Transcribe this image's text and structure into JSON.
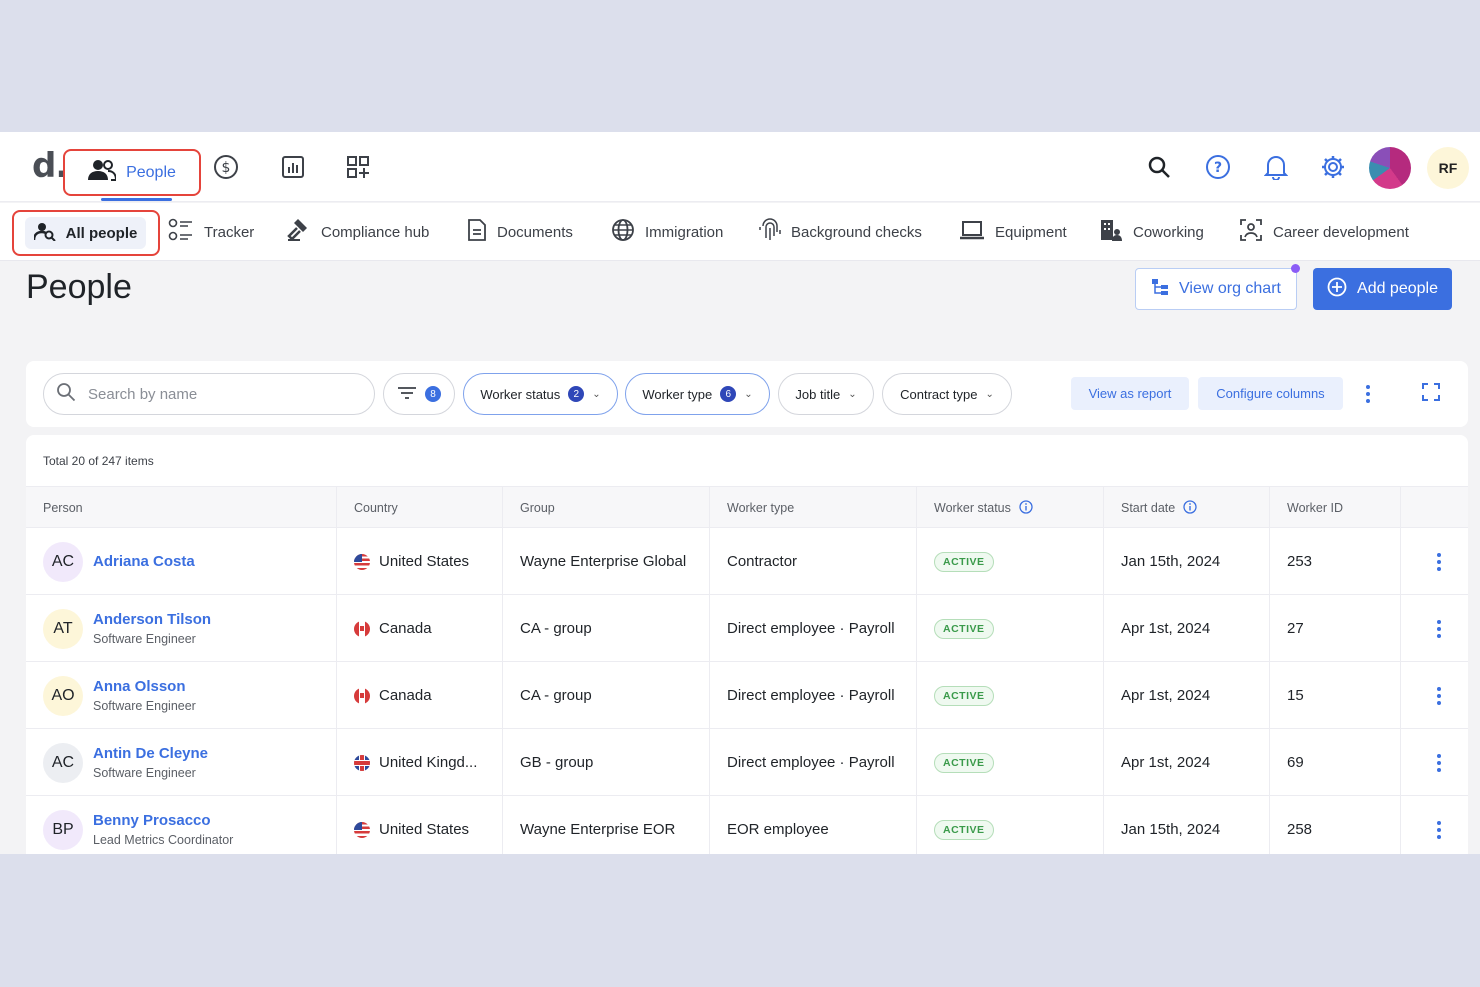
{
  "app": {
    "logo": "d.",
    "nav": {
      "people_label": "People"
    },
    "user_initials": "RF"
  },
  "subnav": {
    "tabs": [
      {
        "label": "All people",
        "active": true,
        "icon": "user-search-icon"
      },
      {
        "label": "Tracker",
        "icon": "checklist-icon"
      },
      {
        "label": "Compliance hub",
        "icon": "gavel-icon"
      },
      {
        "label": "Documents",
        "icon": "document-icon"
      },
      {
        "label": "Immigration",
        "icon": "globe-icon"
      },
      {
        "label": "Background checks",
        "icon": "fingerprint-icon"
      },
      {
        "label": "Equipment",
        "icon": "laptop-icon"
      },
      {
        "label": "Coworking",
        "icon": "building-icon"
      },
      {
        "label": "Career development",
        "icon": "career-icon"
      }
    ]
  },
  "page": {
    "title": "People",
    "view_org_chart": "View org chart",
    "add_people": "Add people"
  },
  "filters": {
    "search_placeholder": "Search by name",
    "filter_count": "8",
    "worker_status": {
      "label": "Worker status",
      "count": "2"
    },
    "worker_type": {
      "label": "Worker type",
      "count": "6"
    },
    "job_title": "Job title",
    "contract_type": "Contract type",
    "view_as_report": "View as report",
    "configure_columns": "Configure columns"
  },
  "table": {
    "total": "Total 20 of 247 items",
    "columns": [
      "Person",
      "Country",
      "Group",
      "Worker type",
      "Worker status",
      "Start date",
      "Worker ID"
    ],
    "rows": [
      {
        "initials": "AC",
        "name": "Adriana Costa",
        "title": "",
        "flag": "us",
        "country": "United States",
        "group": "Wayne Enterprise Global",
        "worker_type": "Contractor",
        "status": "ACTIVE",
        "start": "Jan 15th, 2024",
        "id": "253",
        "avatar_color": "#f1e9fb"
      },
      {
        "initials": "AT",
        "name": "Anderson Tilson",
        "title": "Software Engineer",
        "flag": "ca",
        "country": "Canada",
        "group": "CA - group",
        "worker_type": "Direct employee · Payroll",
        "status": "ACTIVE",
        "start": "Apr 1st, 2024",
        "id": "27",
        "avatar_color": "#fdf6d9"
      },
      {
        "initials": "AO",
        "name": "Anna Olsson",
        "title": "Software Engineer",
        "flag": "ca",
        "country": "Canada",
        "group": "CA - group",
        "worker_type": "Direct employee · Payroll",
        "status": "ACTIVE",
        "start": "Apr 1st, 2024",
        "id": "15",
        "avatar_color": "#fdf6d9"
      },
      {
        "initials": "AC",
        "name": "Antin De Cleyne",
        "title": "Software Engineer",
        "flag": "gb",
        "country": "United Kingd...",
        "group": "GB - group",
        "worker_type": "Direct employee · Payroll",
        "status": "ACTIVE",
        "start": "Apr 1st, 2024",
        "id": "69",
        "avatar_color": "#eceef2"
      },
      {
        "initials": "BP",
        "name": "Benny Prosacco",
        "title": "Lead Metrics Coordinator",
        "flag": "us",
        "country": "United States",
        "group": "Wayne Enterprise EOR",
        "worker_type": "EOR employee",
        "status": "ACTIVE",
        "start": "Jan 15th, 2024",
        "id": "258",
        "avatar_color": "#f1e9fb"
      }
    ]
  },
  "colors": {
    "accent": "#3b6fe0",
    "highlight": "#e5443b",
    "active_green": "#3a9a4a"
  }
}
